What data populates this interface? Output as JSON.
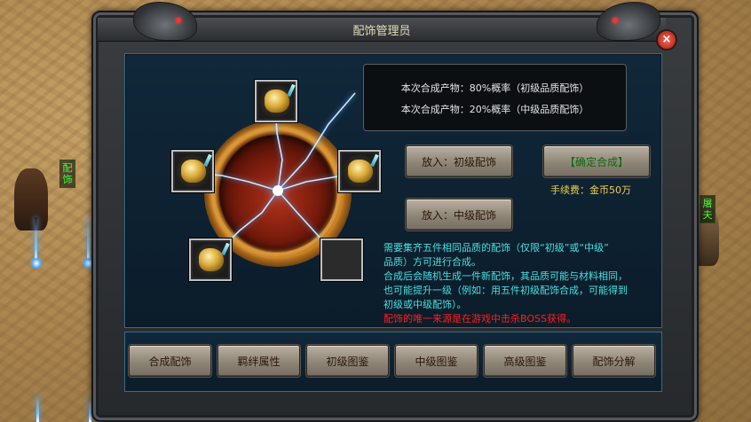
{
  "window": {
    "title": "配饰管理员",
    "close_label": "×"
  },
  "npc_left": {
    "name_tag": "配饰"
  },
  "npc_right": {
    "name_tag": "屠夫"
  },
  "info": {
    "line1": "本次合成产物：80%概率（初级品质配饰）",
    "line2": "本次合成产物：20%概率（中级品质配饰）"
  },
  "slots": [
    {
      "name": "slot-top",
      "filled": true
    },
    {
      "name": "slot-left",
      "filled": true
    },
    {
      "name": "slot-right",
      "filled": true
    },
    {
      "name": "slot-bottom-left",
      "filled": true
    },
    {
      "name": "slot-bottom-right",
      "filled": false
    }
  ],
  "actions": {
    "put_primary": "放入：初级配饰",
    "put_middle": "放入：中级配饰",
    "confirm": "【确定合成】",
    "fee": "手续费：金币50万"
  },
  "description": {
    "line1": "需要集齐五件相同品质的配饰（仅限“初级”或“中级”",
    "line2": "品质）方可进行合成。",
    "line3": "合成后会随机生成一件新配饰，其品质可能与材料相同，",
    "line4": "也可能提升一级（例如：用五件初级配饰合成，可能得到",
    "line5": "初级或中级配饰）。",
    "line6": "配饰的唯一来源是在游戏中击杀BOSS获得。"
  },
  "tabs": [
    {
      "label": "合成配饰"
    },
    {
      "label": "羁绊属性"
    },
    {
      "label": "初级图鉴"
    },
    {
      "label": "中级图鉴"
    },
    {
      "label": "高级图鉴"
    },
    {
      "label": "配饰分解"
    }
  ],
  "colors": {
    "accent_cyan": "#48e0e0",
    "warning_red": "#ff2020",
    "fee_gold": "#f0d050",
    "confirm_green": "#0a6a0a"
  }
}
